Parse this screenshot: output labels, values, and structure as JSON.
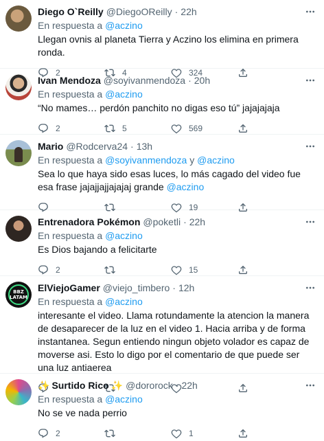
{
  "reply_prefix": "En respuesta a",
  "tweets": [
    {
      "name": "Diego O`Reilly",
      "handle": "@DiegoOReilly",
      "time": "22h",
      "reply_to": [
        "@aczino"
      ],
      "text": "Llegan ovnis al planeta Tierra y Aczino los elimina en primera ronda.",
      "mention": "",
      "counts": {
        "reply": "2",
        "retweet": "4",
        "like": "324"
      }
    },
    {
      "name": "Ivan Mendoza",
      "handle": "@soyivanmendoza",
      "time": "20h",
      "reply_to": [
        "@aczino"
      ],
      "text": "“No mames… perdón panchito no digas eso tú” jajajajaja",
      "mention": "",
      "counts": {
        "reply": "2",
        "retweet": "5",
        "like": "569"
      }
    },
    {
      "name": "Mario",
      "handle": "@Rodcerva24",
      "time": "13h",
      "reply_to": [
        "@soyivanmendoza",
        "@aczino"
      ],
      "reply_joiner": "y",
      "text": "Sea lo que haya sido esas luces, lo más cagado del video fue esa frase jajajjajjajajaj grande",
      "mention": "@aczino",
      "counts": {
        "reply": "",
        "retweet": "",
        "like": "19"
      }
    },
    {
      "name": "Entrenadora Pokémon",
      "handle": "@poketli",
      "time": "22h",
      "reply_to": [
        "@aczino"
      ],
      "text": "Es Dios bajando a felicitarte",
      "mention": "",
      "counts": {
        "reply": "2",
        "retweet": "",
        "like": "15"
      }
    },
    {
      "name": "ElViejoGamer",
      "handle": "@viejo_timbero",
      "time": "12h",
      "reply_to": [
        "@aczino"
      ],
      "text": "interesante el video. Llama rotundamente la atencion la manera de desaparecer de la luz en el video 1. Hacia arriba y de forma instantanea. Segun entiendo ningun objeto volador es capaz de moverse asi. Esto lo digo por el comentario de que puede ser una luz antiaerea",
      "mention": "",
      "counts": {
        "reply": "",
        "retweet": "",
        "like": ""
      }
    },
    {
      "name": "Surtido Rico",
      "name_emoji": "✨",
      "handle": "@dororock",
      "time": "22h",
      "reply_to": [
        "@aczino"
      ],
      "text": "No se ve nada perrio",
      "mention": "",
      "counts": {
        "reply": "2",
        "retweet": "",
        "like": "1"
      }
    }
  ],
  "avatar_colors": [
    "#6b5a3e",
    "#b8453a",
    "#7a8c4e",
    "#4a3f3a",
    "#1a1a1a",
    "#8a6fb0"
  ],
  "avatar_badge_text": "BBZ\nLATAM",
  "colors": {
    "accent": "#1d9bf0",
    "muted": "#536471",
    "text": "#0f1419"
  },
  "icons": {
    "more": "more-icon",
    "reply": "reply-icon",
    "retweet": "retweet-icon",
    "like": "like-icon",
    "share": "share-icon"
  }
}
